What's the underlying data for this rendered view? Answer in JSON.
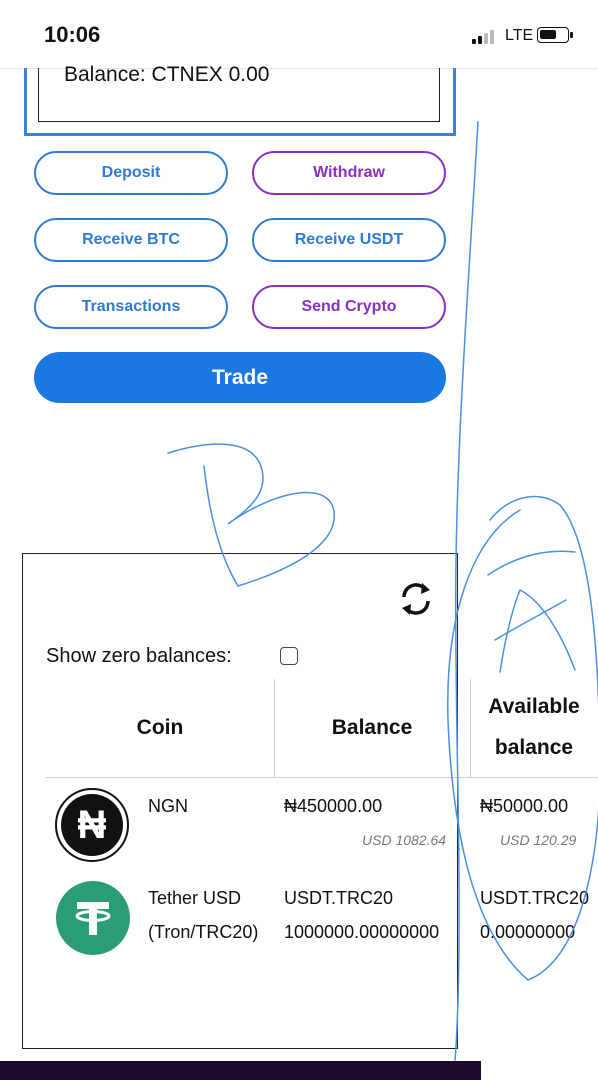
{
  "status_bar": {
    "time": "10:06",
    "network": "LTE"
  },
  "balance": {
    "text": "Balance: CTNEX 0.00"
  },
  "actions": {
    "deposit": "Deposit",
    "withdraw": "Withdraw",
    "receive_btc": "Receive BTC",
    "receive_usdt": "Receive USDT",
    "transactions": "Transactions",
    "send_crypto": "Send Crypto",
    "trade": "Trade"
  },
  "wallet": {
    "show_zero_label": "Show zero balances:",
    "show_zero_checked": false,
    "columns": [
      "Coin",
      "Balance",
      "Available balance"
    ],
    "column_available_lines": [
      "Available",
      "balance"
    ],
    "rows": [
      {
        "icon": "naira-icon",
        "coin": "NGN",
        "balance": "₦450000.00",
        "balance_usd": "USD 1082.64",
        "available": "₦50000.00",
        "available_usd": "USD 120.29"
      },
      {
        "icon": "tether-icon",
        "coin_lines": [
          "Tether USD",
          "(Tron/TRC20)"
        ],
        "balance_lines": [
          "USDT.TRC20",
          "1000000.00000000"
        ],
        "available_lines": [
          "USDT.TRC20",
          "0.00000000"
        ]
      }
    ]
  },
  "colors": {
    "accent_blue": "#2f7bd4",
    "accent_purple": "#8a2fc6",
    "trade_button": "#1a78e0",
    "tether_green": "#2a9d78",
    "annotation_ink": "#4a90e2"
  },
  "annotations": {
    "left_mark": "B",
    "right_mark": "A"
  }
}
